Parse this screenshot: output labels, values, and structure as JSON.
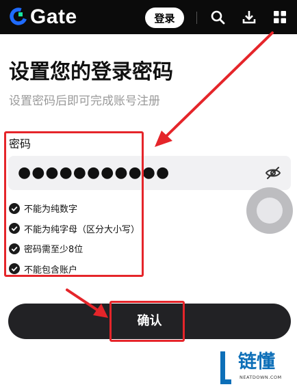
{
  "header": {
    "logo_text": "Gate",
    "login_label": "登录",
    "icons": [
      "search-icon",
      "download-icon",
      "apps-grid-icon"
    ]
  },
  "page": {
    "title": "设置您的登录密码",
    "subtitle": "设置密码后即可完成账号注册"
  },
  "password": {
    "label": "密码",
    "masked_value": "●●●●●●●●●●●",
    "visibility_icon": "eye-off-icon"
  },
  "rules": [
    {
      "text": "不能为纯数字",
      "status": "checked"
    },
    {
      "text": "不能为纯字母（区分大小写）",
      "status": "checked"
    },
    {
      "text": "密码需至少8位",
      "status": "checked"
    },
    {
      "text": "不能包含账户",
      "status": "checked"
    }
  ],
  "confirm_label": "确认",
  "watermark": {
    "brand": "链懂",
    "sub": "NEATDOWN.COM"
  },
  "colors": {
    "header_bg": "#0b0b0b",
    "annotation_red": "#e5252a",
    "button_dark": "#222225",
    "field_bg": "#f1f1f3",
    "logo_blue": "#1f6bff",
    "logo_green": "#17e5a0",
    "watermark_blue": "#0d6fb8"
  }
}
